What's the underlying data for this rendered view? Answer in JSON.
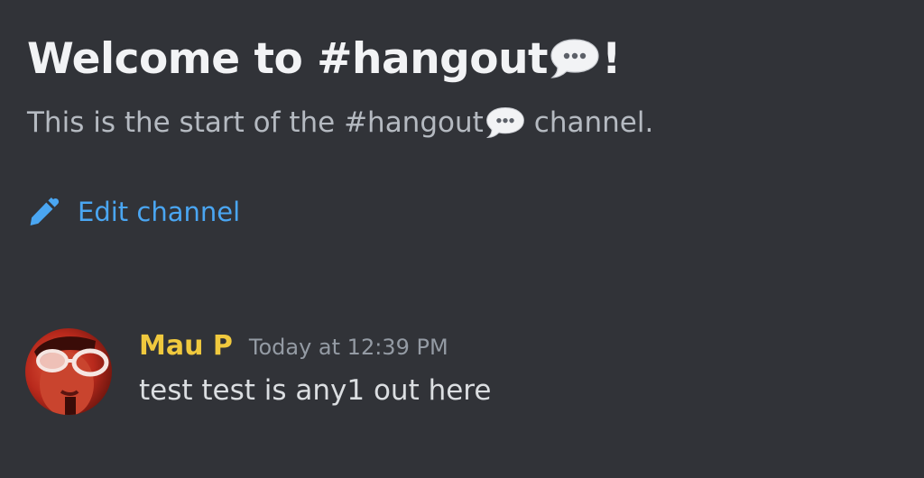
{
  "channel": {
    "welcome_prefix": "Welcome to #hangout",
    "welcome_suffix": "!",
    "start_prefix": "This is the start of the #hangout",
    "start_suffix": "channel.",
    "emoji_icon": "speech-bubble-icon"
  },
  "actions": {
    "edit_channel_label": "Edit channel",
    "edit_icon": "pencil-icon"
  },
  "messages": [
    {
      "author": "Mau P",
      "author_color": "#f0c93e",
      "timestamp": "Today at 12:39 PM",
      "text": "test test is any1 out here"
    }
  ],
  "colors": {
    "background": "#313338",
    "link": "#4aa6f2",
    "muted_text": "#b5bac1",
    "timestamp": "#949ba4"
  }
}
